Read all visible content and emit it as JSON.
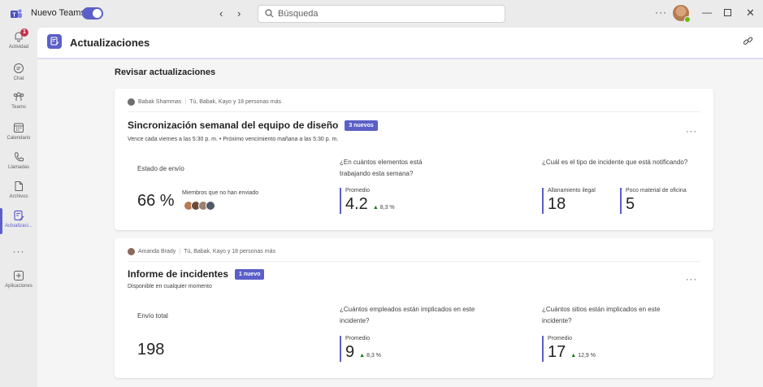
{
  "app": {
    "name": "Nuevo Teams",
    "search_placeholder": "Búsqueda"
  },
  "rail": [
    {
      "label": "Actividad",
      "badge": "1"
    },
    {
      "label": "Chat"
    },
    {
      "label": "Teams"
    },
    {
      "label": "Calendario"
    },
    {
      "label": "Llamadas"
    },
    {
      "label": "Archivos"
    },
    {
      "label": "Actualizaci..."
    },
    {
      "label": "Aplicaciones"
    }
  ],
  "header": {
    "title": "Actualizaciones"
  },
  "section_title": "Revisar actualizaciones",
  "cards": [
    {
      "author": "Babak Shammas",
      "recipients": "Tú, Babak, Kayo y 18 personas más",
      "title": "Sincronización semanal del equipo de diseño",
      "badge": "3 nuevos",
      "subtitle": "Vence cada viernes a las 5:30 p. m. • Próximo vencimiento mañana a las 5:30 p. m.",
      "col1_label": "Estado de envío",
      "col1_value": "66 %",
      "col1_note": "Miembros que no han enviado",
      "col2_question": "¿En cuántos elementos está trabajando esta semana?",
      "col2_stat_label": "Promedio",
      "col2_stat_value": "4.2",
      "col2_delta": "8,3 %",
      "col3_question": "¿Cuál es el tipo de incidente que está notificando?",
      "col3_a_label": "Allanamiento ilegal",
      "col3_a_value": "18",
      "col3_b_label": "Poco material de oficina",
      "col3_b_value": "5"
    },
    {
      "author": "Amanda Brady",
      "recipients": "Tú, Babak, Kayo y 18 personas más",
      "title": "Informe de incidentes",
      "badge": "1 nuevo",
      "subtitle": "Disponible en cualquier momento",
      "col1_label": "Envío total",
      "col1_value": "198",
      "col2_question": "¿Cuántos empleados están implicados en este incidente?",
      "col2_stat_label": "Promedio",
      "col2_stat_value": "9",
      "col2_delta": "8,3 %",
      "col3_question": "¿Cuántos sitios están implicados en este incidente?",
      "col3_stat_label": "Promedio",
      "col3_stat_value": "17",
      "col3_delta": "12,9 %"
    }
  ],
  "colors": {
    "accent": "#5b5fc7",
    "positive": "#107c10",
    "badge": "#c4314b"
  }
}
